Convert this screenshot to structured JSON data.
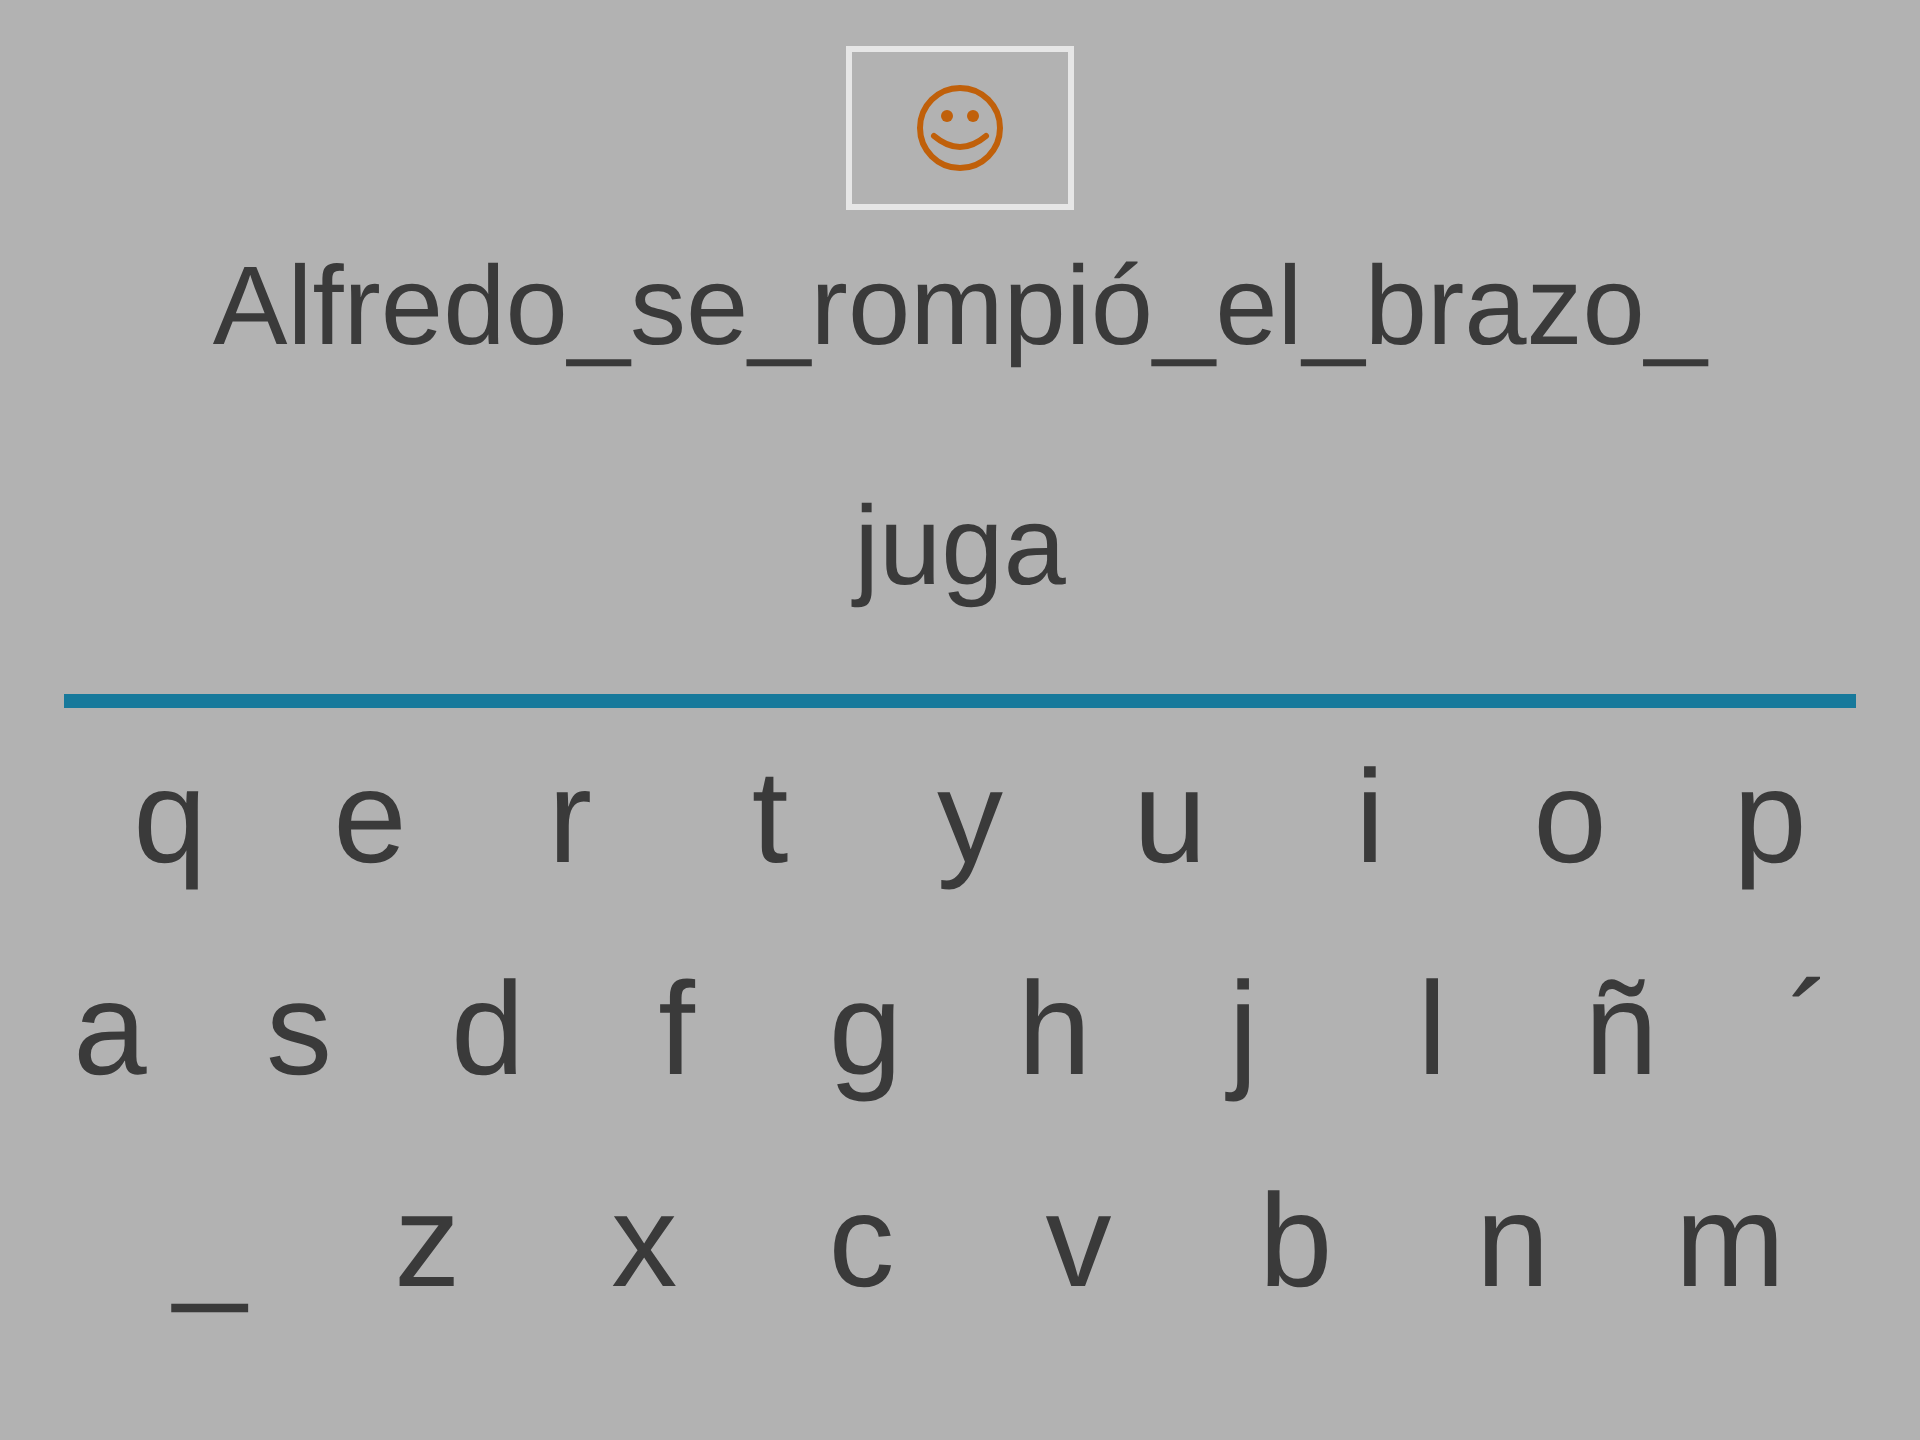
{
  "sentence": {
    "line_1": "Alfredo_se_rompió_el_brazo_",
    "line_2": "juga"
  },
  "keyboard": {
    "rows": [
      [
        "q",
        "e",
        "r",
        "t",
        "y",
        "u",
        "i",
        "o",
        "p"
      ],
      [
        "a",
        "s",
        "d",
        "f",
        "g",
        "h",
        "j",
        "l",
        "ñ",
        "´"
      ],
      [
        "_",
        "z",
        "x",
        "c",
        "v",
        "b",
        "n",
        "m"
      ]
    ]
  }
}
